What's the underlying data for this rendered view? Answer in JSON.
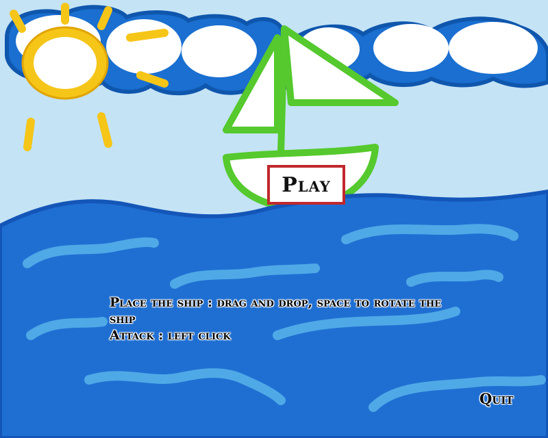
{
  "menu": {
    "play_label": "Play",
    "quit_label": "Quit"
  },
  "instructions": {
    "line1": "Place the ship : drag and drop, space to rotate the ship",
    "line2": "Attack : left click"
  },
  "colors": {
    "sky": "#c4e3f5",
    "sea": "#1f6fd3",
    "sea_outline": "#1456b8",
    "wave": "#4fa9e6",
    "sun": "#f5c518",
    "sun_outline": "#e0a400",
    "boat": "#55c92d",
    "cloud": "#ffffff",
    "cloud_outline": "#1a6fd0",
    "play_border": "#c0282d"
  }
}
